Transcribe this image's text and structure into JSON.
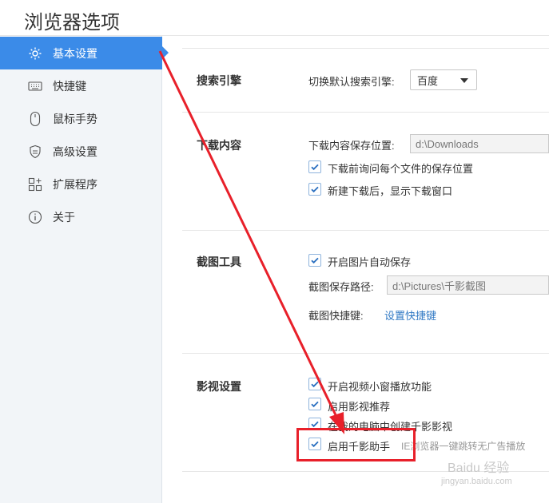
{
  "window": {
    "title": "浏览器选项"
  },
  "sidebar": {
    "items": [
      {
        "label": "基本设置",
        "icon": "gear-icon",
        "active": true
      },
      {
        "label": "快捷键",
        "icon": "keyboard-icon"
      },
      {
        "label": "鼠标手势",
        "icon": "mouse-icon"
      },
      {
        "label": "高级设置",
        "icon": "shield-icon"
      },
      {
        "label": "扩展程序",
        "icon": "extensions-icon"
      },
      {
        "label": "关于",
        "icon": "info-icon"
      }
    ]
  },
  "search": {
    "title": "搜索引擎",
    "switch_label": "切换默认搜索引擎:",
    "engine": "百度"
  },
  "download": {
    "title": "下载内容",
    "path_label": "下载内容保存位置:",
    "path": "d:\\Downloads",
    "ask_each": "下载前询问每个文件的保存位置",
    "show_window": "新建下载后，显示下载窗口"
  },
  "screenshot": {
    "title": "截图工具",
    "auto_save": "开启图片自动保存",
    "path_label": "截图保存路径:",
    "path": "d:\\Pictures\\千影截图",
    "shortcut_label": "截图快捷键:",
    "shortcut_link": "设置快捷键"
  },
  "video": {
    "title": "影视设置",
    "small_window": "开启视频小窗播放功能",
    "recommend": "启用影视推荐",
    "create_desktop": "在我的电脑中创建千影影视",
    "assistant": "启用千影助手",
    "assistant_hint": "IE浏览器一键跳转无广告播放"
  },
  "watermark": {
    "text": "Baidu 经验",
    "url": "jingyan.baidu.com"
  },
  "colors": {
    "accent": "#3b8be8",
    "annotation": "#e8202a",
    "link": "#2f78c4"
  }
}
